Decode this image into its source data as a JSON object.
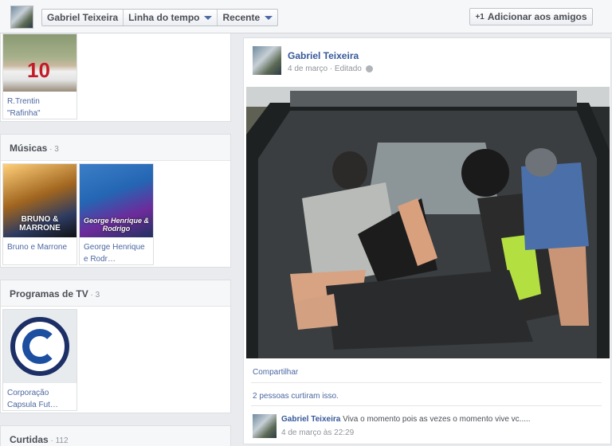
{
  "topbar": {
    "profile_name": "Gabriel Teixeira",
    "timeline_label": "Linha do tempo",
    "recent_label": "Recente",
    "add_friend_label": "Adicionar aos amigos"
  },
  "left": {
    "player": {
      "label": "R.Trentin \"Rafinha\"",
      "jersey": "10"
    },
    "music": {
      "title": "Músicas",
      "count": "3",
      "items": [
        {
          "label": "Bruno e Marrone",
          "art_text": "BRUNO & MARRONE"
        },
        {
          "label": "George Henrique e Rodr…",
          "art_text": "George Henrique & Rodrigo"
        }
      ]
    },
    "tv": {
      "title": "Programas de TV",
      "count": "3",
      "items": [
        {
          "label": "Corporação Capsula Fut…"
        }
      ]
    },
    "likes": {
      "title": "Curtidas",
      "count": "112"
    }
  },
  "post": {
    "author": "Gabriel Teixeira",
    "date": "4 de março",
    "edited": "Editado",
    "share_label": "Compartilhar",
    "likes_text": "2 pessoas curtiram isso.",
    "comment": {
      "author": "Gabriel Teixeira",
      "text": "Viva o momento pois as vezes o momento vive vc.....",
      "time": "4 de março às 22:29"
    }
  },
  "colors": {
    "link": "#365899",
    "topbar_bg": "#f6f7f9",
    "page_bg": "#e9ebee"
  }
}
